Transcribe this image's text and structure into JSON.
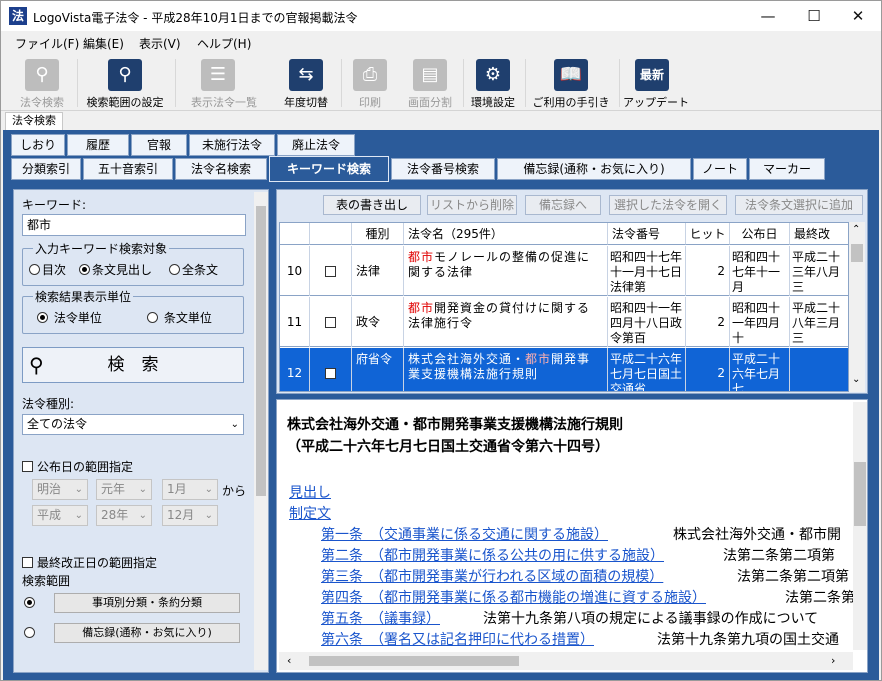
{
  "window": {
    "icon": "法",
    "title": "LogoVista電子法令 - 平成28年10月1日までの官報掲載法令"
  },
  "menu": [
    "ファイル(F)",
    "編集(E)",
    "表示(V)",
    "ヘルプ(H)"
  ],
  "toolbar": [
    {
      "label": "法令検索",
      "icon": "search-icon",
      "enabled": false
    },
    {
      "label": "検索範囲の設定",
      "icon": "search-range-icon",
      "enabled": true
    },
    {
      "label": "表示法令一覧",
      "icon": "list-icon",
      "enabled": false
    },
    {
      "label": "年度切替",
      "icon": "switch-arrows-icon",
      "enabled": true
    },
    {
      "label": "印刷",
      "icon": "printer-icon",
      "enabled": false
    },
    {
      "label": "画面分割",
      "icon": "split-screen-icon",
      "enabled": false
    },
    {
      "label": "環境設定",
      "icon": "gear-icon",
      "enabled": true
    },
    {
      "label": "ご利用の手引き",
      "icon": "book-icon",
      "enabled": true
    },
    {
      "label": "アップデート",
      "icon": "update-icon",
      "enabled": true,
      "icon_text": "最新"
    }
  ],
  "section_tab": "法令検索",
  "tabs_row1": [
    "しおり",
    "履歴",
    "官報",
    "未施行法令",
    "廃止法令"
  ],
  "tabs_row2": [
    "分類索引",
    "五十音索引",
    "法令名検索",
    "キーワード検索",
    "法令番号検索",
    "備忘録(通称・お気に入り)",
    "ノート",
    "マーカー"
  ],
  "selected_tab": "キーワード検索",
  "left": {
    "keyword_label": "キーワード:",
    "keyword_value": "都市",
    "target_group": "入力キーワード検索対象",
    "target_options": [
      "目次",
      "条文見出し",
      "全条文"
    ],
    "target_selected": "条文見出し",
    "unit_group": "検索結果表示単位",
    "unit_options": [
      "法令単位",
      "条文単位"
    ],
    "unit_selected": "法令単位",
    "search_button": "検　索",
    "type_label": "法令種別:",
    "type_value": "全ての法令",
    "promul_check": "公布日の範囲指定",
    "from_era": "明治",
    "from_year": "元年",
    "from_month": "1月",
    "from_suffix": "から",
    "to_era": "平成",
    "to_year": "28年",
    "to_month": "12月",
    "amend_check": "最終改正日の範囲指定",
    "scope_label": "検索範囲",
    "scope_btn1": "事項別分類・条約分類",
    "scope_btn2": "備忘録(通称・お気に入り)"
  },
  "result": {
    "buttons": [
      "表の書き出し",
      "リストから削除",
      "備忘録へ",
      "選択した法令を開く",
      "法令条文選択に追加"
    ],
    "headers": [
      "種別",
      "法令名（295件）",
      "法令番号",
      "ヒット",
      "公布日",
      "最終改"
    ],
    "rows": [
      {
        "no": "10",
        "kind": "法律",
        "name_pre": "",
        "name_red": "都市",
        "name_post": "モノレールの整備の促進に関する法律",
        "number": "昭和四十七年十一月十七日法律第",
        "hits": "2",
        "date": "昭和四十七年十一月",
        "last": "平成二十三年八月三"
      },
      {
        "no": "11",
        "kind": "政令",
        "name_pre": "",
        "name_red": "都市",
        "name_post": "開発資金の貸付けに関する法律施行令",
        "number": "昭和四十一年四月十八日政令第百",
        "hits": "2",
        "date": "昭和四十一年四月十",
        "last": "平成二十八年三月三"
      },
      {
        "no": "12",
        "kind": "府省令",
        "name_pre": "株式会社海外交通・",
        "name_red": "都市",
        "name_post": "開発事業支援機構法施行規則",
        "number": "平成二十六年七月七日国土交通省",
        "hits": "2",
        "date": "平成二十六年七月七",
        "last": ""
      }
    ]
  },
  "document": {
    "title1": "株式会社海外交通・都市開発事業支援機構法施行規則",
    "title2": "（平成二十六年七月七日国土交通省令第六十四号）",
    "links": [
      "見出し",
      "制定文"
    ],
    "articles": [
      {
        "link": "第一条　（交通事業に係る交通に関する施設）",
        "text": "株式会社海外交通・都市開"
      },
      {
        "link": "第二条　（都市開発事業に係る公共の用に供する施設）",
        "text": "法第二条第二項第"
      },
      {
        "link": "第三条　（都市開発事業が行われる区域の面積の規模）",
        "text": "法第二条第二項第"
      },
      {
        "link": "第四条　（都市開発事業に係る都市機能の増進に資する施設）",
        "text": "法第二条第"
      },
      {
        "link": "第五条　（議事録）",
        "text": "法第十九条第八項の規定による議事録の作成について"
      },
      {
        "link": "第六条　（署名又は記名押印に代わる措置）",
        "text": "法第十九条第九項の国土交通"
      }
    ]
  }
}
